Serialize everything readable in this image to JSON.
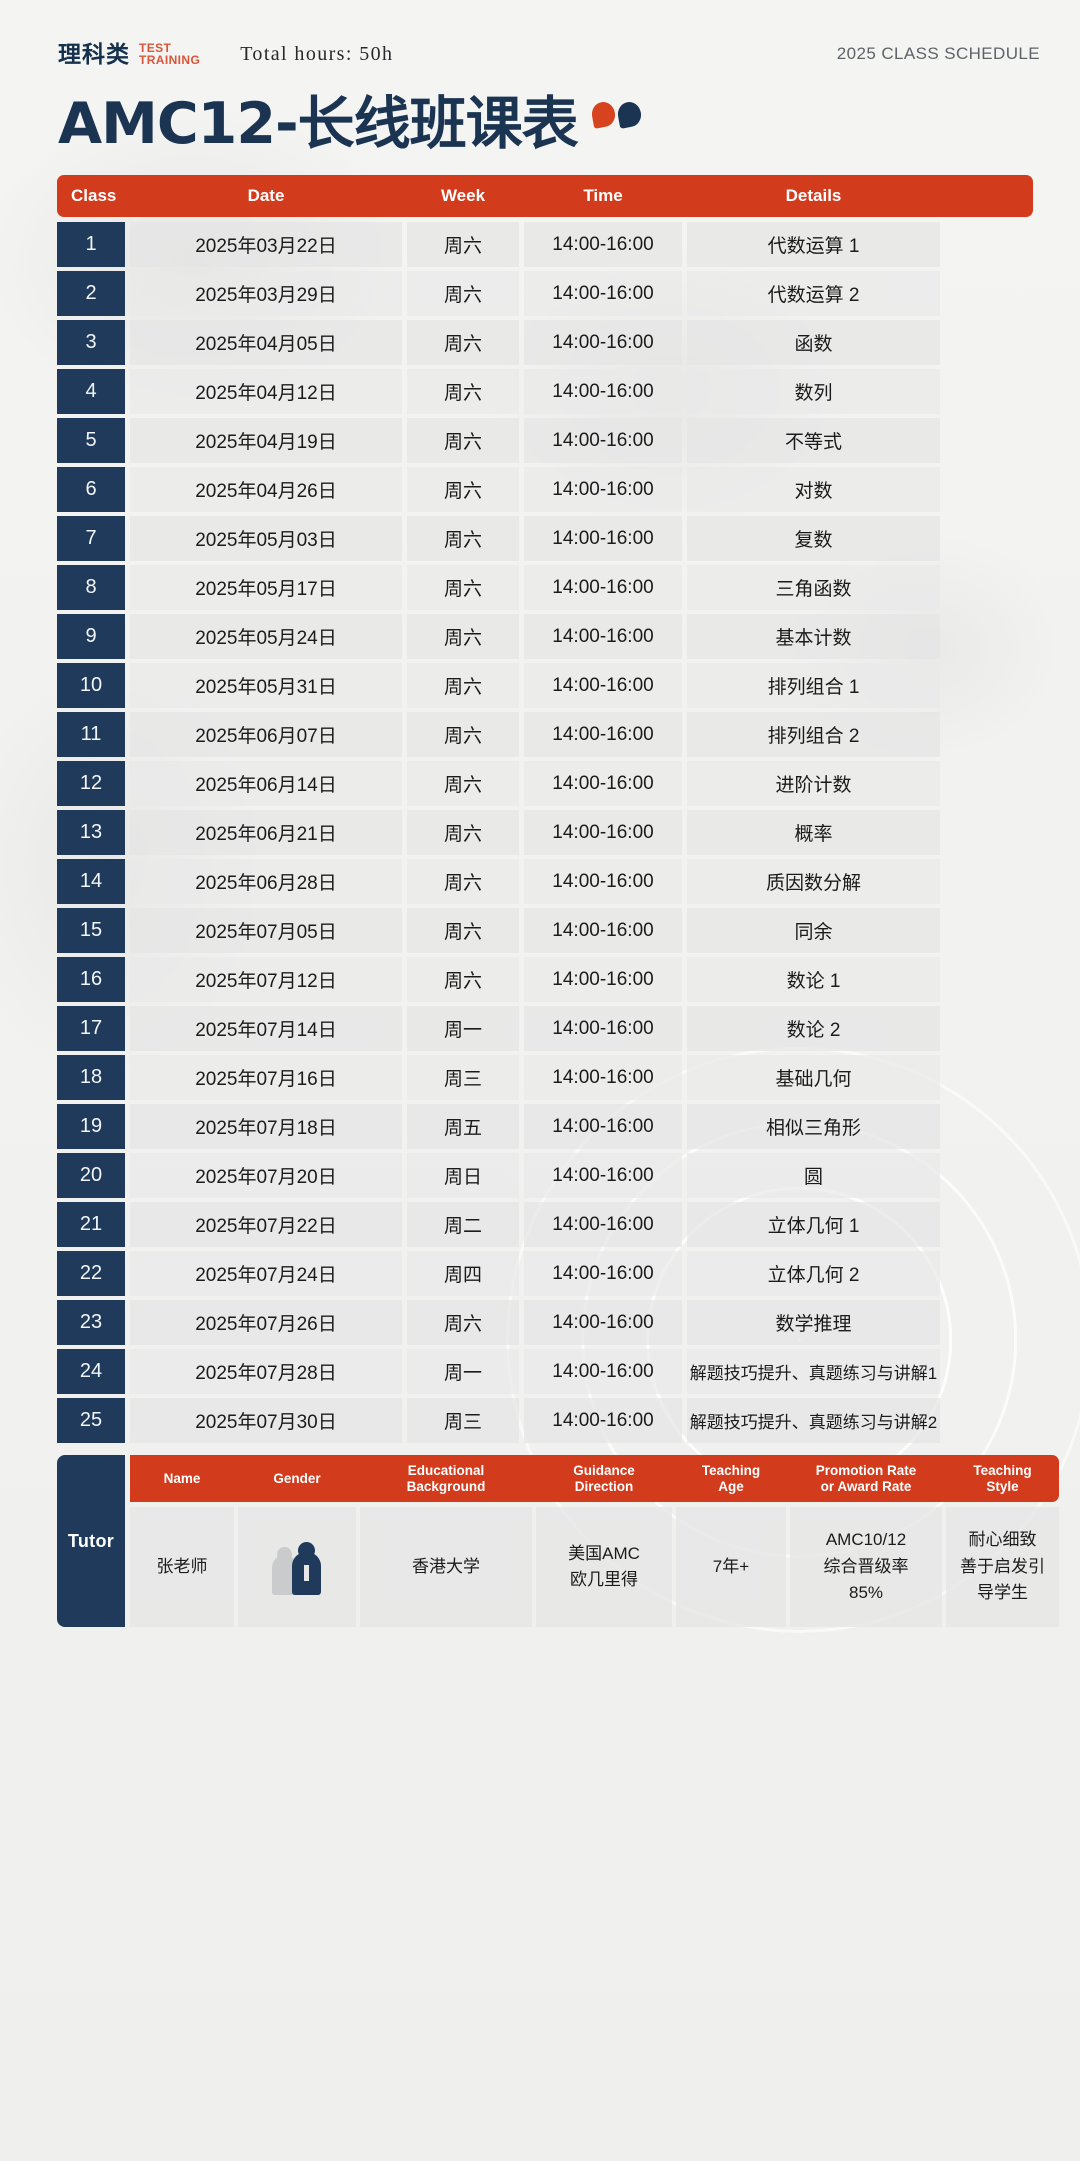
{
  "header": {
    "brand_cn": "理科类",
    "brand_en_line1": "TEST",
    "brand_en_line2": "TRAINING",
    "total_hours": "Total hours: 50h",
    "schedule_year": "2025 CLASS SCHEDULE",
    "title": "AMC12-长线班课表"
  },
  "table": {
    "columns": [
      "Class",
      "Date",
      "Week",
      "Time",
      "Details"
    ],
    "rows": [
      {
        "no": "1",
        "date": "2025年03月22日",
        "week": "周六",
        "time": "14:00-16:00",
        "details": "代数运算 1"
      },
      {
        "no": "2",
        "date": "2025年03月29日",
        "week": "周六",
        "time": "14:00-16:00",
        "details": "代数运算 2"
      },
      {
        "no": "3",
        "date": "2025年04月05日",
        "week": "周六",
        "time": "14:00-16:00",
        "details": "函数"
      },
      {
        "no": "4",
        "date": "2025年04月12日",
        "week": "周六",
        "time": "14:00-16:00",
        "details": "数列"
      },
      {
        "no": "5",
        "date": "2025年04月19日",
        "week": "周六",
        "time": "14:00-16:00",
        "details": "不等式"
      },
      {
        "no": "6",
        "date": "2025年04月26日",
        "week": "周六",
        "time": "14:00-16:00",
        "details": "对数"
      },
      {
        "no": "7",
        "date": "2025年05月03日",
        "week": "周六",
        "time": "14:00-16:00",
        "details": "复数"
      },
      {
        "no": "8",
        "date": "2025年05月17日",
        "week": "周六",
        "time": "14:00-16:00",
        "details": "三角函数"
      },
      {
        "no": "9",
        "date": "2025年05月24日",
        "week": "周六",
        "time": "14:00-16:00",
        "details": "基本计数"
      },
      {
        "no": "10",
        "date": "2025年05月31日",
        "week": "周六",
        "time": "14:00-16:00",
        "details": "排列组合 1"
      },
      {
        "no": "11",
        "date": "2025年06月07日",
        "week": "周六",
        "time": "14:00-16:00",
        "details": "排列组合 2"
      },
      {
        "no": "12",
        "date": "2025年06月14日",
        "week": "周六",
        "time": "14:00-16:00",
        "details": "进阶计数"
      },
      {
        "no": "13",
        "date": "2025年06月21日",
        "week": "周六",
        "time": "14:00-16:00",
        "details": "概率"
      },
      {
        "no": "14",
        "date": "2025年06月28日",
        "week": "周六",
        "time": "14:00-16:00",
        "details": "质因数分解"
      },
      {
        "no": "15",
        "date": "2025年07月05日",
        "week": "周六",
        "time": "14:00-16:00",
        "details": "同余"
      },
      {
        "no": "16",
        "date": "2025年07月12日",
        "week": "周六",
        "time": "14:00-16:00",
        "details": "数论 1"
      },
      {
        "no": "17",
        "date": "2025年07月14日",
        "week": "周一",
        "time": "14:00-16:00",
        "details": "数论 2"
      },
      {
        "no": "18",
        "date": "2025年07月16日",
        "week": "周三",
        "time": "14:00-16:00",
        "details": "基础几何"
      },
      {
        "no": "19",
        "date": "2025年07月18日",
        "week": "周五",
        "time": "14:00-16:00",
        "details": "相似三角形"
      },
      {
        "no": "20",
        "date": "2025年07月20日",
        "week": "周日",
        "time": "14:00-16:00",
        "details": "圆"
      },
      {
        "no": "21",
        "date": "2025年07月22日",
        "week": "周二",
        "time": "14:00-16:00",
        "details": "立体几何 1"
      },
      {
        "no": "22",
        "date": "2025年07月24日",
        "week": "周四",
        "time": "14:00-16:00",
        "details": "立体几何 2"
      },
      {
        "no": "23",
        "date": "2025年07月26日",
        "week": "周六",
        "time": "14:00-16:00",
        "details": "数学推理"
      },
      {
        "no": "24",
        "date": "2025年07月28日",
        "week": "周一",
        "time": "14:00-16:00",
        "details": "解题技巧提升、真题练习与讲解1"
      },
      {
        "no": "25",
        "date": "2025年07月30日",
        "week": "周三",
        "time": "14:00-16:00",
        "details": "解题技巧提升、真题练习与讲解2"
      }
    ]
  },
  "tutor": {
    "row_label": "Tutor",
    "columns": {
      "name": "Name",
      "gender": "Gender",
      "education_line1": "Educational",
      "education_line2": "Background",
      "guidance_line1": "Guidance",
      "guidance_line2": "Direction",
      "age_line1": "Teaching",
      "age_line2": "Age",
      "promotion_line1": "Promotion Rate",
      "promotion_line2": "or Award Rate",
      "style_line1": "Teaching",
      "style_line2": "Style"
    },
    "values": {
      "name": "张老师",
      "gender_icon": "teacher-avatar",
      "education": "香港大学",
      "guidance_line1": "美国AMC",
      "guidance_line2": "欧几里得",
      "teaching_age": "7年+",
      "promotion_line1": "AMC10/12",
      "promotion_line2": "综合晋级率",
      "promotion_line3": "85%",
      "style_line1": "耐心细致",
      "style_line2": "善于启发引",
      "style_line3": "导学生"
    }
  },
  "colors": {
    "accent_red": "#d23b1c",
    "navy": "#1f3a5a",
    "page_bg": "#f2f2f0",
    "cell_bg": "#e5e5e5"
  }
}
